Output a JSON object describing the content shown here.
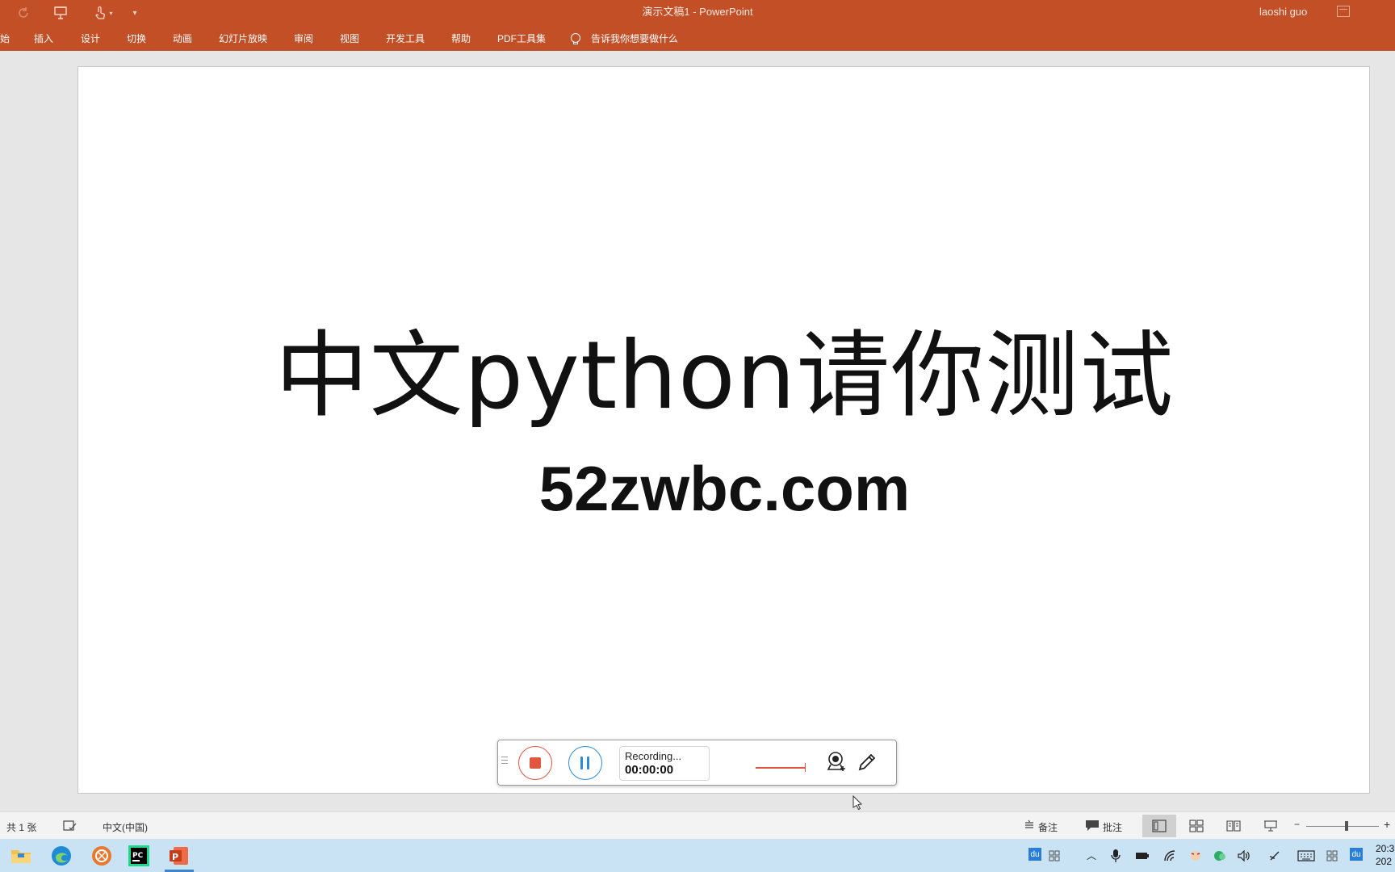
{
  "window": {
    "title": "演示文稿1  -  PowerPoint",
    "user": "laoshi guo"
  },
  "ribbon": {
    "tabs": [
      "始",
      "插入",
      "设计",
      "切换",
      "动画",
      "幻灯片放映",
      "审阅",
      "视图",
      "开发工具",
      "帮助",
      "PDF工具集"
    ],
    "tell_me": "告诉我你想要做什么"
  },
  "slide": {
    "title": "中文python请你测试",
    "subtitle": "52zwbc.com"
  },
  "recorder": {
    "status": "Recording...",
    "time": "00:00:00"
  },
  "statusbar": {
    "slide_count": "共 1 张",
    "language": "中文(中国)",
    "notes": "备注",
    "comments": "批注"
  },
  "taskbar": {
    "tray_du": "du",
    "clock_time": "20:3",
    "clock_date": "202"
  },
  "colors": {
    "accent": "#c34f27",
    "record": "#e2553f",
    "pause": "#2a8cd6",
    "taskbar": "#c9e3f4"
  }
}
